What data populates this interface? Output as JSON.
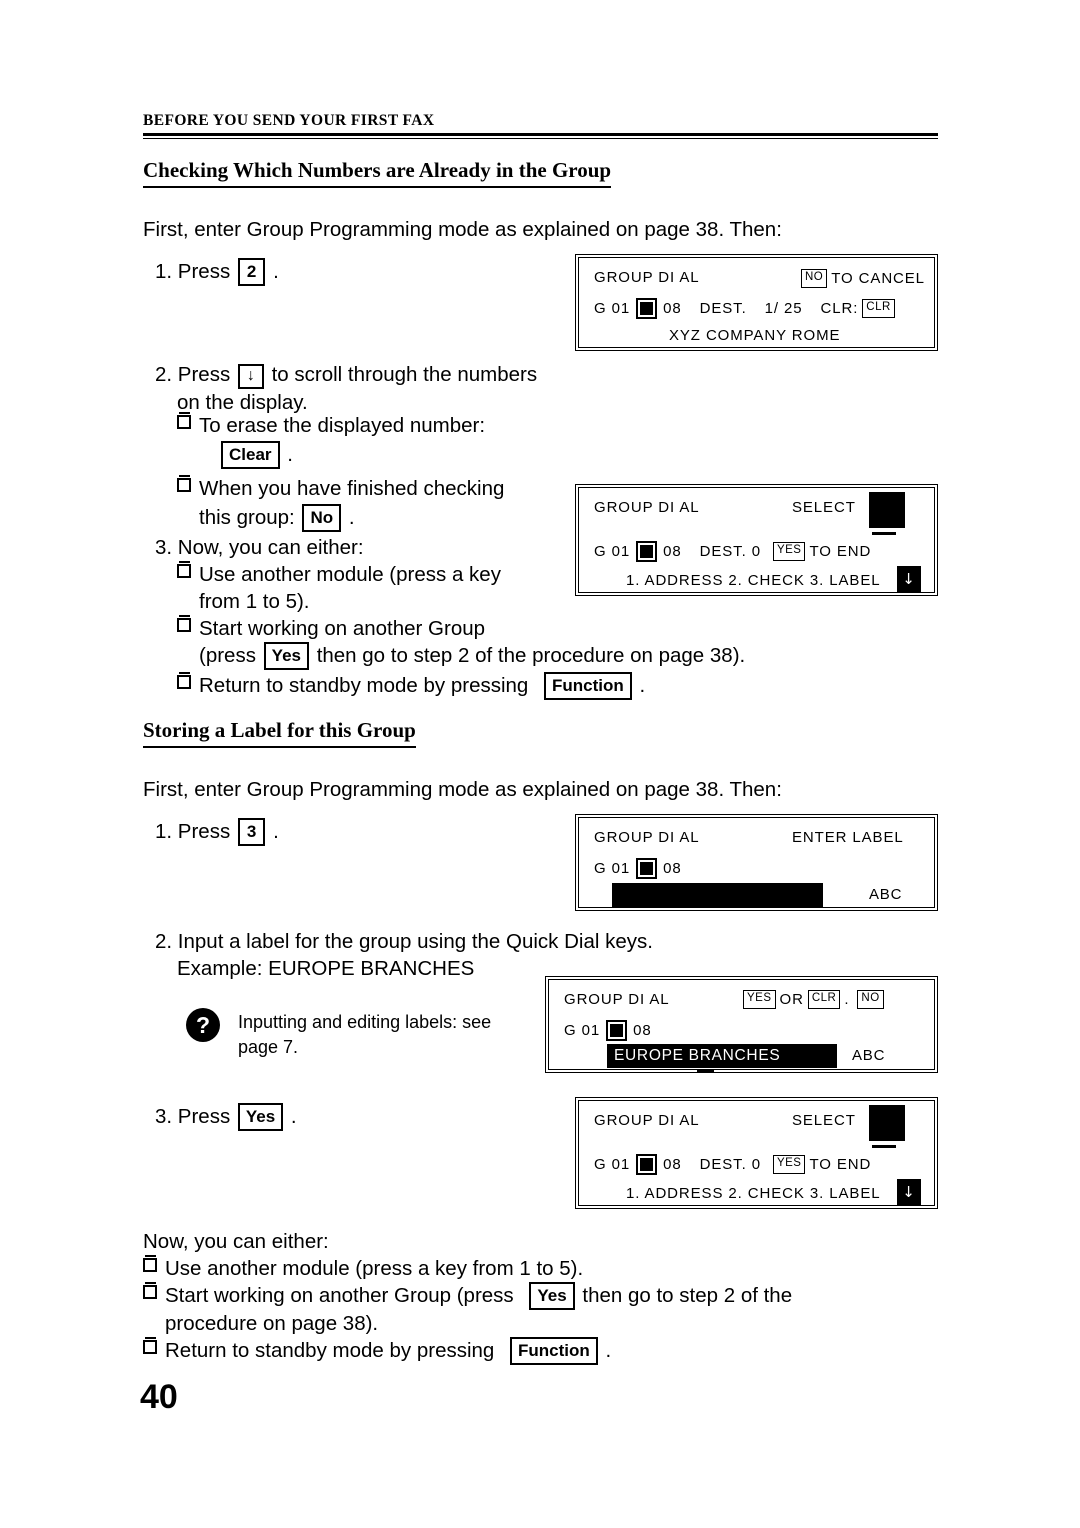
{
  "running_header": "BEFORE YOU SEND YOUR FIRST FAX",
  "page_number": "40",
  "section1": {
    "heading": "Checking Which Numbers are Already in the Group",
    "intro": "First, enter Group Programming mode as explained on page  38. Then:",
    "step1_pre": "1. Press",
    "step1_key": "2",
    "step1_post": ".",
    "step2_pre": "2. Press",
    "step2_key": "↓",
    "step2_mid": "to scroll through the numbers",
    "step2_line2": "on the display.",
    "b1_text": "To erase the displayed number:",
    "b1_key": "Clear",
    "b1_post": ".",
    "b2_line1": "When you have finished checking",
    "b2_line2_pre": "this group:",
    "b2_key": "No",
    "b2_post": ".",
    "step3": "3. Now, you can either:",
    "b3_line1": "Use another module (press a key",
    "b3_line2": "from 1 to 5).",
    "b4_line1": "Start working on another Group",
    "b4_line2_pre": "(press",
    "b4_key": "Yes",
    "b4_line2_post": "then go to step 2 of the procedure on page  38).",
    "b5_pre": "Return to standby mode by pressing",
    "b5_key": "Function",
    "b5_post": "."
  },
  "section2": {
    "heading": "Storing a Label for this Group",
    "intro": "First, enter Group Programming mode as explained on page  38. Then:",
    "step1_pre": "1. Press",
    "step1_key": "3",
    "step1_post": ".",
    "step2_line1": "2. Input a label for the group using the Quick Dial keys.",
    "step2_line2": "Example: EUROPE BRANCHES",
    "note_icon": "question-mark-icon",
    "note_line1": "Inputting and editing labels: see",
    "note_line2": "page 7.",
    "step3_pre": "3. Press",
    "step3_key": "Yes",
    "step3_post": ".",
    "outro": "Now, you can either:",
    "o1": "Use another module (press a key from 1 to 5).",
    "o2_pre": "Start working on another Group (press",
    "o2_key": "Yes",
    "o2_post": "then go to step 2 of the",
    "o2_line2": "procedure on page  38).",
    "o3_pre": "Return to standby mode by pressing",
    "o3_key": "Function",
    "o3_post": "."
  },
  "lcd1": {
    "line1_left": "GROUP DI AL",
    "line1_key": "NO",
    "line1_right": "TO CANCEL",
    "line2_a": "G 01",
    "line2_b": "08",
    "line2_c": "DEST.",
    "line2_d": "1/ 25",
    "line2_e": "CLR:",
    "line2_key": "CLR",
    "line3": "XYZ COMPANY ROME"
  },
  "lcd2": {
    "line1_left": "GROUP DI AL",
    "line1_right": "SELECT",
    "line2_a": "G 01",
    "line2_b": "08",
    "line2_c": "DEST. 0",
    "line2_key": "YES",
    "line2_d": "TO END",
    "line3": "1. ADDRESS 2. CHECK 3. LABEL",
    "down_arrow": "↓"
  },
  "lcd3": {
    "line1_left": "GROUP DI AL",
    "line1_right": "ENTER LABEL",
    "line2_a": "G 01",
    "line2_b": "08",
    "label_value": "",
    "mode": "ABC"
  },
  "lcd4": {
    "line1_left": "GROUP DI AL",
    "line1_key1": "YES",
    "line1_mid": "OR",
    "line1_key2": "CLR",
    "line1_dot": ".",
    "line1_key3": "NO",
    "line2_a": "G 01",
    "line2_b": "08",
    "label_value": "EUROPE BRANCHES",
    "mode": "ABC"
  },
  "lcd5": {
    "line1_left": "GROUP DI AL",
    "line1_right": "SELECT",
    "line2_a": "G 01",
    "line2_b": "08",
    "line2_c": "DEST. 0",
    "line2_key": "YES",
    "line2_d": "TO END",
    "line3": "1. ADDRESS 2. CHECK 3. LABEL",
    "down_arrow": "↓"
  }
}
